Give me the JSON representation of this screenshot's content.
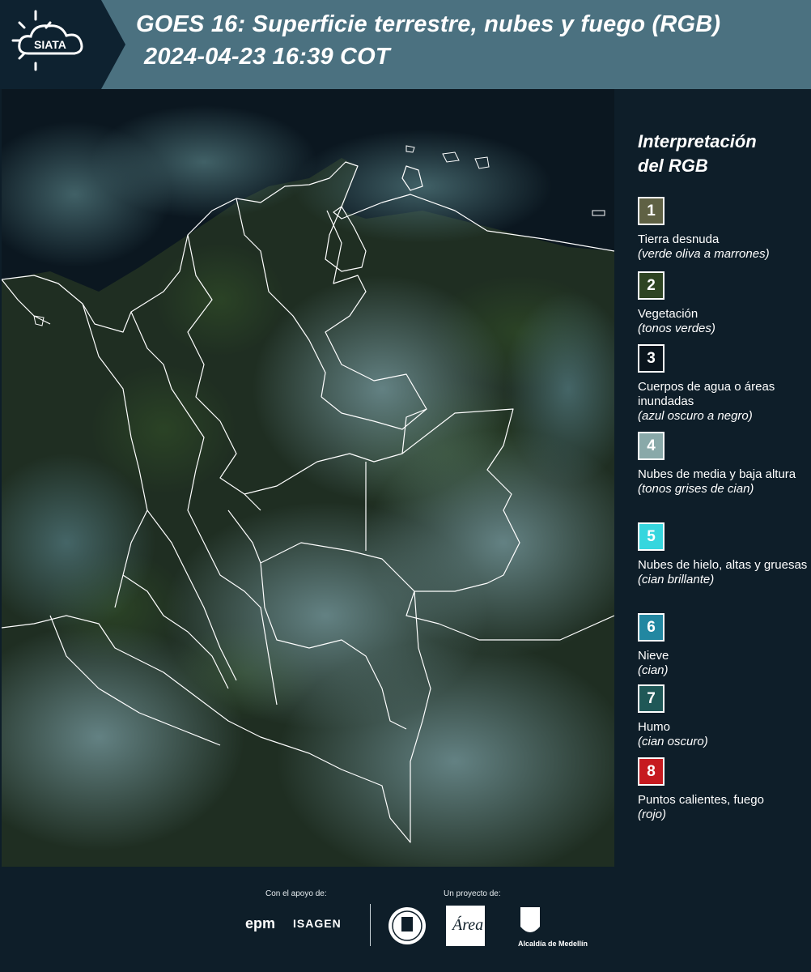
{
  "header": {
    "logo_text": "SIATA",
    "title_line1": "GOES 16: Superficie terrestre, nubes y fuego (RGB)",
    "title_line2": "2024-04-23 16:39 COT"
  },
  "legend": {
    "title": "Interpretación\ndel RGB",
    "items": [
      {
        "num": "1",
        "color": "#5f6144",
        "label": "Tierra desnuda",
        "sub": "(verde oliva a marrones)"
      },
      {
        "num": "2",
        "color": "#2e4422",
        "label": "Vegetación",
        "sub": "(tonos verdes)"
      },
      {
        "num": "3",
        "color": "#0a151d",
        "label": "Cuerpos de agua o áreas inundadas",
        "sub": "(azul oscuro a negro)"
      },
      {
        "num": "4",
        "color": "#89a9a9",
        "label": "Nubes de media y baja altura",
        "sub": "(tonos grises de cian)"
      },
      {
        "num": "5",
        "color": "#36d6de",
        "label": "Nubes de hielo, altas y gruesas",
        "sub": "(cian brillante)"
      },
      {
        "num": "6",
        "color": "#2287a1",
        "label": "Nieve",
        "sub": "(cian)"
      },
      {
        "num": "7",
        "color": "#1f5857",
        "label": "Humo",
        "sub": "(cian oscuro)"
      },
      {
        "num": "8",
        "color": "#c61a1f",
        "label": "Puntos calientes, fuego",
        "sub": "(rojo)"
      }
    ]
  },
  "footer": {
    "support_label": "Con el apoyo de:",
    "project_label": "Un proyecto de:",
    "sponsor_1": "epm",
    "sponsor_2": "ISAGEN",
    "partner_amva": "Área Metropolitana",
    "partner_alcaldia": "Alcaldía de Medellín"
  },
  "colors": {
    "header_bg": "#4b7180",
    "page_bg": "#0e1e29",
    "map_ocean": "#0b1720",
    "map_land": "#23331f",
    "map_cloud": "#5c7f83"
  }
}
